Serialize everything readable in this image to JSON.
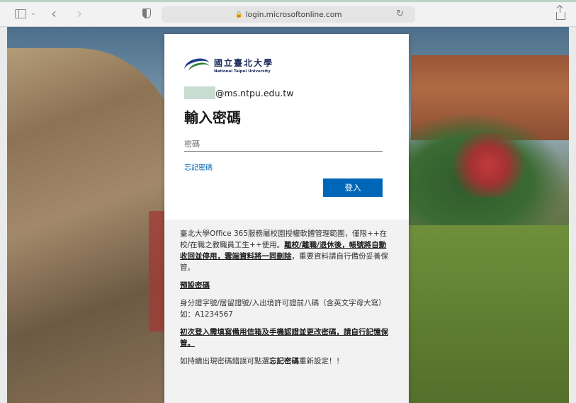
{
  "browser": {
    "url": "login.microsoftonline.com",
    "icons": {
      "sidebar": "sidebar-icon",
      "back": "chevron-left-icon",
      "forward": "chevron-right-icon",
      "privacy": "shield-icon",
      "lock": "lock-icon",
      "reload": "reload-icon",
      "share": "share-icon"
    }
  },
  "login": {
    "org_name_cn": "國立臺北大學",
    "org_name_en": "National Taipei University",
    "account_suffix": "@ms.ntpu.edu.tw",
    "heading": "輸入密碼",
    "password_placeholder": "密碼",
    "forgot_link": "忘記密碼",
    "signin_button": "登入",
    "accent_color": "#0067b8"
  },
  "notice": {
    "p1_a": "臺北大學Office 365服務屬校園授權軟體管理範圍，僅限++在校/在職之教職員工生++使用。",
    "p1_b": "離校/離職/退休後，帳號將自動收回並停用，雲端資料將一同刪除",
    "p1_c": "，重要資料請自行備份妥善保管。",
    "default_pw_title": "預設密碼",
    "default_pw_text": "身分證字號/居留證號/入出境許可證前八碼（含英文字母大寫）如：A1234567",
    "first_login": "初次登入需填寫備用信箱及手機認證並更改密碼，請自行記憶保管。",
    "retry_a": "如持續出現密碼錯誤可點選",
    "retry_b": "忘記密碼",
    "retry_c": "重新設定！！"
  }
}
